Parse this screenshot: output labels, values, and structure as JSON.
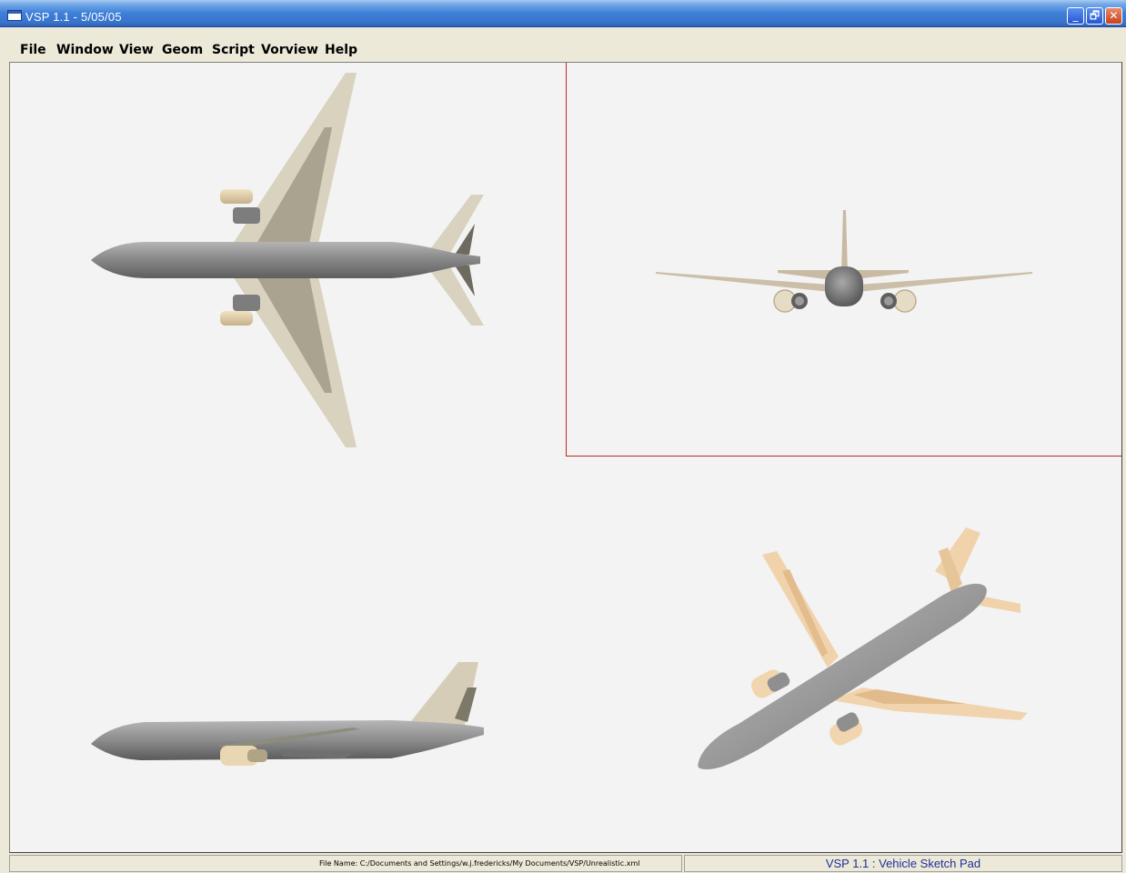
{
  "window": {
    "title": "VSP 1.1 - 5/05/05",
    "controls": {
      "minimize": "_",
      "maximize": "🗗",
      "close": "✕"
    }
  },
  "menu": {
    "items": [
      {
        "label": "File"
      },
      {
        "label": "Window"
      },
      {
        "label": "View"
      },
      {
        "label": "Geom"
      },
      {
        "label": "Script"
      },
      {
        "label": "Vorview"
      },
      {
        "label": "Help"
      }
    ]
  },
  "viewports": [
    {
      "view": "top",
      "active": false
    },
    {
      "view": "front",
      "active": true
    },
    {
      "view": "side",
      "active": false
    },
    {
      "view": "isometric",
      "active": false
    }
  ],
  "status": {
    "file_name": "File Name: C:/Documents and Settings/w.j.fredericks/My Documents/VSP/Unrealistic.xml",
    "app_name": "VSP 1.1 : Vehicle Sketch Pad"
  },
  "colors": {
    "viewport_bg": "#f3f3f3",
    "active_border": "#b42a22",
    "fuselage": "#8e8e8e",
    "wing": "#d9cdb5",
    "wing_iso": "#f1d3ae",
    "status_text": "#1f2f9c"
  }
}
